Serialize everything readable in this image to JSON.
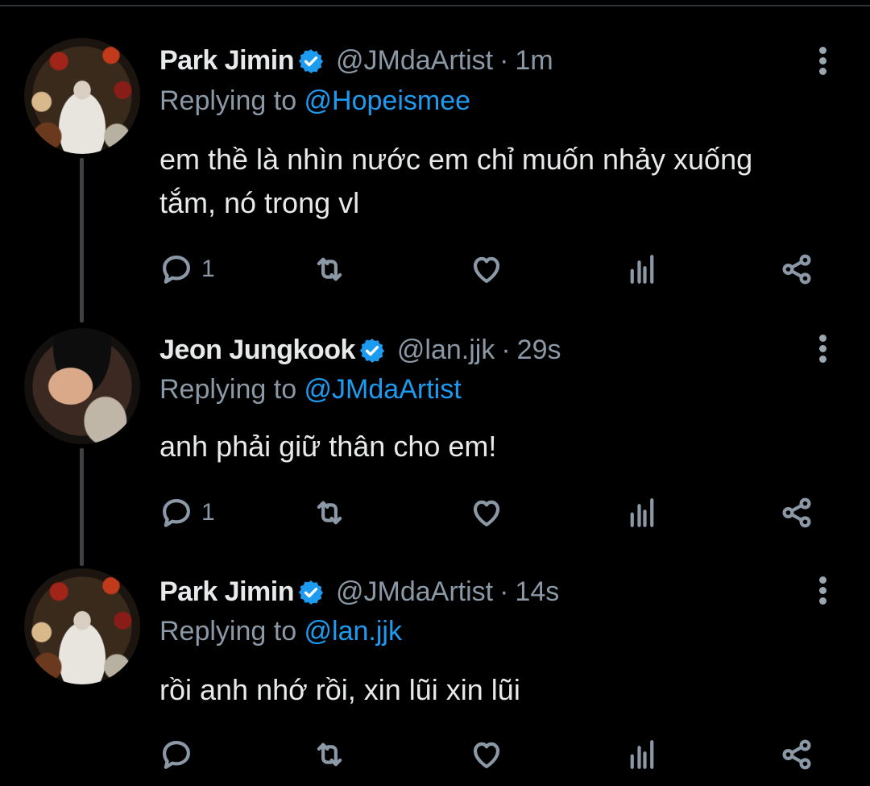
{
  "colors": {
    "background": "#000000",
    "text": "#e7e9ea",
    "secondary": "#8b98a5",
    "link": "#1d9bf0",
    "verified": "#1d9bf0"
  },
  "tweets": [
    {
      "name": "Park Jimin",
      "handle": "@JMdaArtist",
      "separator": "·",
      "time": "1m",
      "replying_prefix": "Replying to ",
      "replying_to": "@Hopeismee",
      "text": "em thề là nhìn nước em chỉ muốn nhảy xuống tắm, nó trong vl",
      "reply_count": "1",
      "icons": [
        "reply-icon",
        "retweet-icon",
        "like-icon",
        "analytics-icon",
        "share-icon"
      ]
    },
    {
      "name": "Jeon Jungkook",
      "handle": "@lan.jjk",
      "separator": "·",
      "time": "29s",
      "replying_prefix": "Replying to ",
      "replying_to": "@JMdaArtist",
      "text": "anh phải giữ thân cho em!",
      "reply_count": "1",
      "icons": [
        "reply-icon",
        "retweet-icon",
        "like-icon",
        "analytics-icon",
        "share-icon"
      ]
    },
    {
      "name": "Park Jimin",
      "handle": "@JMdaArtist",
      "separator": "·",
      "time": "14s",
      "replying_prefix": "Replying to ",
      "replying_to": "@lan.jjk",
      "text": "rồi anh nhớ rồi, xin lũi xin lũi",
      "reply_count": "",
      "icons": [
        "reply-icon",
        "retweet-icon",
        "like-icon",
        "analytics-icon",
        "share-icon"
      ]
    }
  ]
}
